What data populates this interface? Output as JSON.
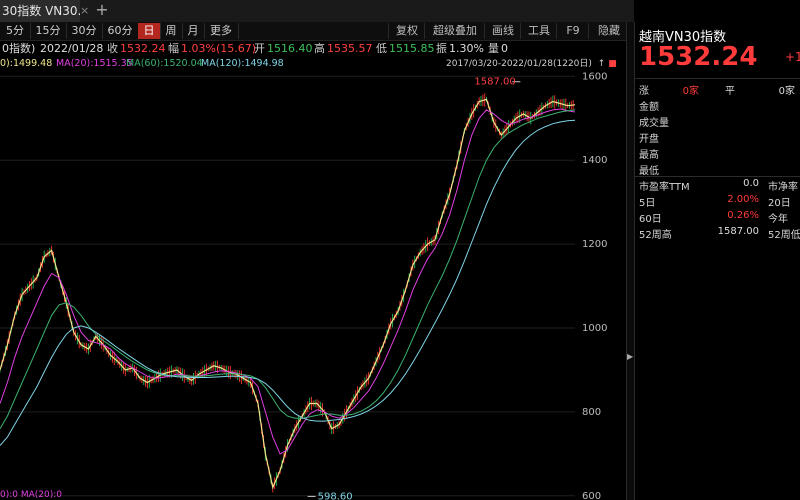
{
  "window": {
    "tab_title": "30指数 VN30.",
    "close_glyph": "×",
    "add_glyph": "+"
  },
  "toolbar": {
    "periods": [
      "5分",
      "15分",
      "30分",
      "60分",
      "日",
      "周",
      "月",
      "更多"
    ],
    "active_period": "日",
    "tools": [
      "复权",
      "超级叠加",
      "画线",
      "工具",
      "F9",
      "隐藏"
    ]
  },
  "info": {
    "name": "0指数)",
    "date": "2022/01/28",
    "close_label": "收",
    "close_value": "1532.24",
    "change_label": "幅",
    "change_value": "1.03%(15.67)",
    "open_label": "开",
    "open_value": "1516.40",
    "high_label": "高",
    "high_value": "1535.57",
    "low_label": "低",
    "low_value": "1515.85",
    "amp_label": "振",
    "amp_value": "1.30%",
    "vol_label": "量",
    "vol_value": "0"
  },
  "ma": {
    "ma5": "0):1499.48",
    "ma20": "MA(20):1515.35",
    "ma60": "MA(60):1520.04",
    "ma120": "MA(120):1494.98",
    "bottom": "0):0  MA(20):0",
    "colors": {
      "ma5": "#f0e68c",
      "ma20": "#e040e0",
      "ma60": "#3cb371",
      "ma120": "#7fd4e6"
    }
  },
  "chart_header": {
    "range": "2017/03/20-2022/01/28(1220日)"
  },
  "chart_data": {
    "type": "line",
    "y_ticks": [
      "1600",
      "1400",
      "1200",
      "1000",
      "800",
      "600"
    ],
    "ylim": [
      590,
      1615
    ],
    "high_marker": "1587.00",
    "low_marker": "598.60",
    "series": [
      {
        "name": "MA5",
        "values": [
          900,
          960,
          1030,
          1080,
          1100,
          1120,
          1170,
          1185,
          1120,
          1060,
          990,
          960,
          950,
          980,
          960,
          935,
          920,
          900,
          905,
          880,
          870,
          880,
          890,
          895,
          900,
          885,
          875,
          890,
          900,
          910,
          905,
          895,
          890,
          880,
          870,
          820,
          700,
          620,
          660,
          720,
          760,
          790,
          820,
          820,
          800,
          760,
          770,
          800,
          830,
          860,
          880,
          920,
          960,
          1010,
          1040,
          1090,
          1150,
          1180,
          1200,
          1210,
          1270,
          1320,
          1390,
          1470,
          1510,
          1540,
          1545,
          1490,
          1460,
          1480,
          1500,
          1510,
          1500,
          1515,
          1530,
          1540,
          1535,
          1530,
          1532
        ]
      },
      {
        "name": "MA20",
        "values": [
          820,
          870,
          930,
          980,
          1020,
          1060,
          1100,
          1130,
          1120,
          1080,
          1030,
          990,
          970,
          965,
          960,
          950,
          930,
          915,
          905,
          895,
          885,
          880,
          882,
          885,
          890,
          888,
          884,
          886,
          890,
          895,
          898,
          896,
          893,
          888,
          880,
          860,
          800,
          740,
          700,
          710,
          740,
          770,
          795,
          805,
          800,
          790,
          785,
          795,
          810,
          830,
          850,
          880,
          915,
          955,
          995,
          1040,
          1090,
          1130,
          1165,
          1190,
          1225,
          1270,
          1330,
          1400,
          1460,
          1500,
          1520,
          1510,
          1495,
          1485,
          1490,
          1498,
          1502,
          1508,
          1515,
          1520,
          1522,
          1518,
          1515
        ]
      },
      {
        "name": "MA60",
        "values": [
          760,
          790,
          830,
          870,
          910,
          950,
          990,
          1030,
          1055,
          1060,
          1050,
          1030,
          1005,
          985,
          970,
          958,
          945,
          932,
          920,
          910,
          900,
          893,
          888,
          886,
          886,
          886,
          885,
          885,
          886,
          888,
          890,
          891,
          891,
          889,
          886,
          878,
          858,
          832,
          805,
          790,
          785,
          785,
          788,
          792,
          795,
          795,
          792,
          792,
          795,
          802,
          812,
          826,
          845,
          870,
          900,
          935,
          975,
          1015,
          1055,
          1090,
          1125,
          1165,
          1210,
          1260,
          1310,
          1360,
          1400,
          1430,
          1450,
          1465,
          1475,
          1485,
          1492,
          1500,
          1505,
          1510,
          1515,
          1518,
          1520
        ]
      },
      {
        "name": "MA120",
        "values": [
          720,
          740,
          770,
          800,
          830,
          860,
          895,
          930,
          960,
          985,
          1000,
          1005,
          1000,
          990,
          978,
          965,
          952,
          940,
          928,
          916,
          905,
          896,
          890,
          886,
          884,
          883,
          882,
          882,
          882,
          883,
          884,
          885,
          885,
          884,
          882,
          878,
          868,
          852,
          832,
          812,
          796,
          786,
          780,
          778,
          778,
          780,
          782,
          785,
          789,
          795,
          803,
          814,
          828,
          845,
          866,
          890,
          918,
          948,
          980,
          1012,
          1045,
          1080,
          1118,
          1160,
          1205,
          1250,
          1295,
          1335,
          1370,
          1400,
          1425,
          1445,
          1460,
          1472,
          1480,
          1487,
          1491,
          1494,
          1495
        ]
      }
    ]
  },
  "quote": {
    "title": "越南VN30指数",
    "price": "1532.24",
    "change": "+1",
    "rows": [
      {
        "label": "涨",
        "value": "0家",
        "label2": "平",
        "value2": "0家"
      },
      {
        "label": "金额",
        "value": ""
      },
      {
        "label": "成交量",
        "value": ""
      },
      {
        "label": "开盘",
        "value": ""
      },
      {
        "label": "最高",
        "value": ""
      },
      {
        "label": "最低",
        "value": ""
      }
    ],
    "stats": [
      {
        "label": "市盈率TTM",
        "value": "0.0",
        "label2": "市净率"
      },
      {
        "label": "5日",
        "value": "2.00%",
        "label2": "20日"
      },
      {
        "label": "60日",
        "value": "0.26%",
        "label2": "今年"
      },
      {
        "label": "52周高",
        "value": "1587.00",
        "label2": "52周低"
      }
    ],
    "up_color": "#ff3b3b"
  }
}
